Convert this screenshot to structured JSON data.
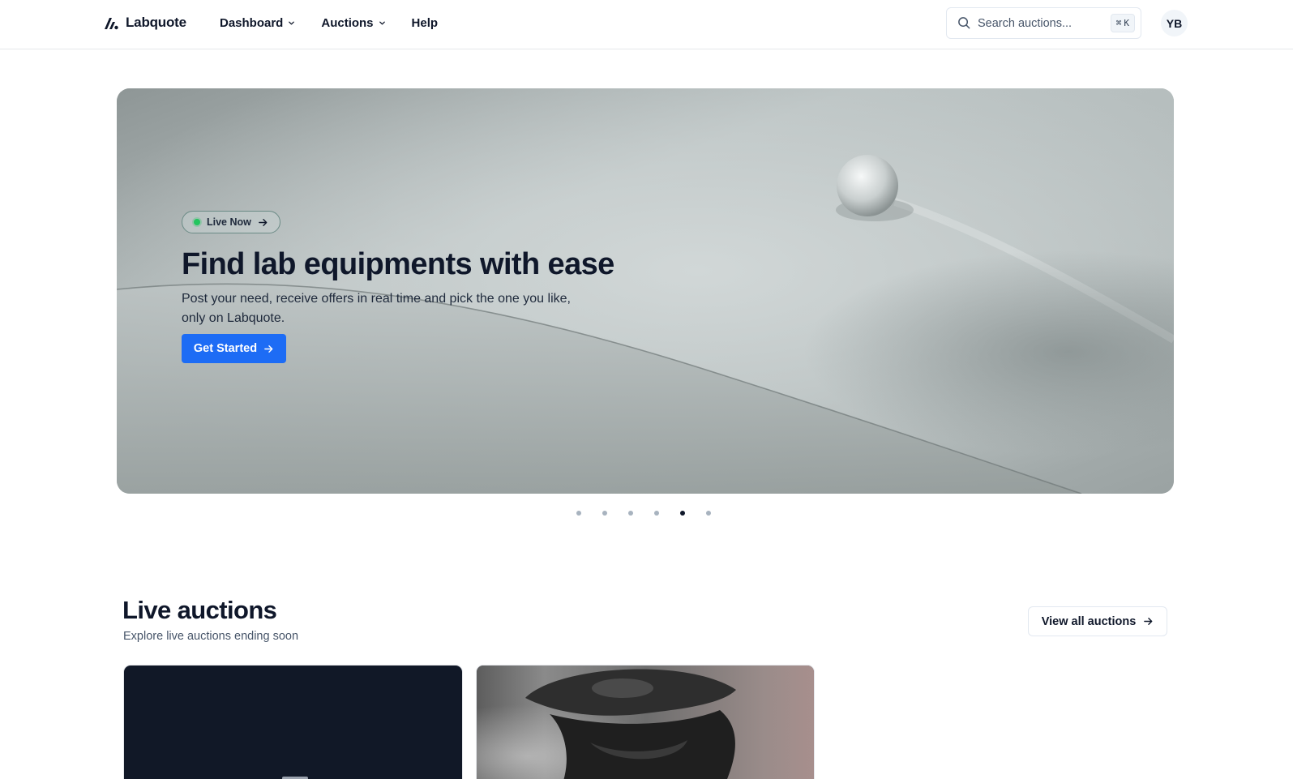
{
  "header": {
    "brand": "Labquote",
    "nav": [
      {
        "label": "Dashboard",
        "has_menu": true
      },
      {
        "label": "Auctions",
        "has_menu": true
      },
      {
        "label": "Help",
        "has_menu": false
      }
    ],
    "search": {
      "placeholder": "Search auctions...",
      "shortcut_symbol": "⌘",
      "shortcut_key": "K",
      "icon": "search-icon"
    },
    "avatar_initials": "YB"
  },
  "hero": {
    "badge_label": "Live Now",
    "badge_status_color": "#22c55e",
    "title": "Find lab equipments with ease",
    "subtitle": "Post your need, receive offers in real time and pick the one you like, only on Labquote.",
    "cta_label": "Get Started",
    "cta_color": "#1d6cf5"
  },
  "carousel": {
    "slide_count": 6,
    "active_index": 4
  },
  "live_auctions": {
    "title": "Live auctions",
    "subtitle": "Explore live auctions ending soon",
    "view_all_label": "View all auctions"
  },
  "colors": {
    "text_primary": "#0f172a",
    "text_muted": "#475569",
    "border": "#e2e8f0"
  }
}
